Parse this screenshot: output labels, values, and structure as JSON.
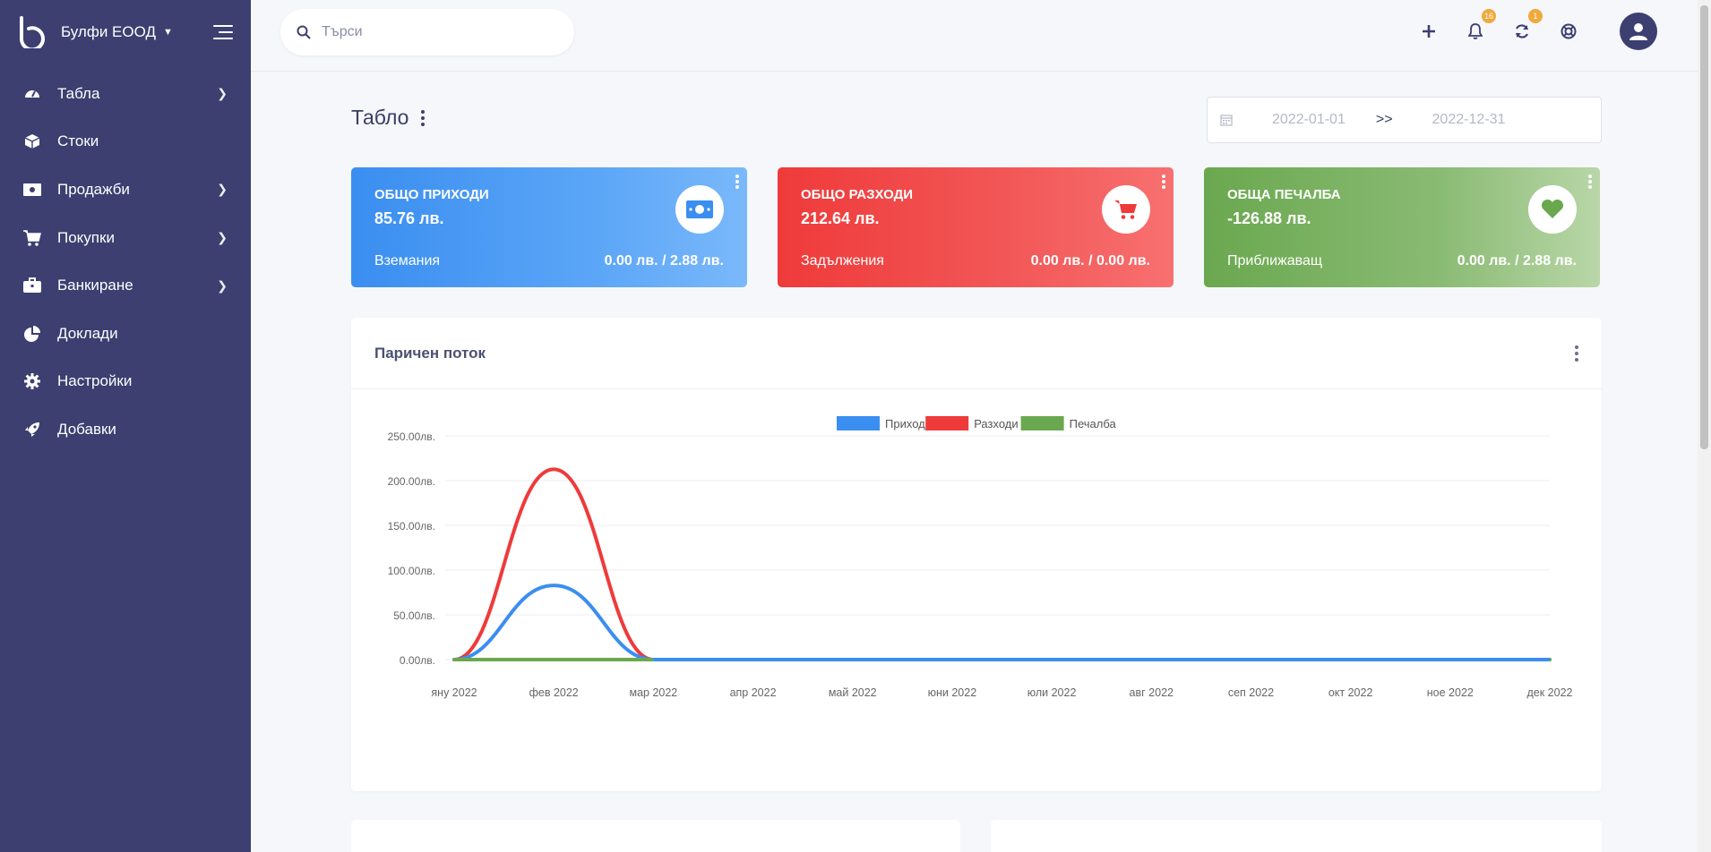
{
  "sidebar": {
    "company": "Булфи ЕООД",
    "items": [
      {
        "label": "Табла",
        "icon": "gauge-icon",
        "has_children": true
      },
      {
        "label": "Стоки",
        "icon": "cube-icon",
        "has_children": false
      },
      {
        "label": "Продажби",
        "icon": "money-bill-icon",
        "has_children": true
      },
      {
        "label": "Покупки",
        "icon": "shopping-cart-icon",
        "has_children": true
      },
      {
        "label": "Банкиране",
        "icon": "briefcase-icon",
        "has_children": true
      },
      {
        "label": "Доклади",
        "icon": "chart-pie-icon",
        "has_children": false
      },
      {
        "label": "Настройки",
        "icon": "gear-icon",
        "has_children": false
      },
      {
        "label": "Добавки",
        "icon": "rocket-icon",
        "has_children": false
      }
    ]
  },
  "topbar": {
    "search_placeholder": "Търси",
    "notifications_count": "16",
    "updates_count": "1"
  },
  "dashboard": {
    "title": "Табло",
    "date_from": "2022-01-01",
    "date_sep": ">>",
    "date_to": "2022-12-31"
  },
  "cards": {
    "income": {
      "title": "ОБЩО ПРИХОДИ",
      "amount": "85.76 лв.",
      "sub_label": "Вземания",
      "sub_value": "0.00 лв. / 2.88 лв.",
      "color": "#3a8ef0"
    },
    "expense": {
      "title": "ОБЩО РАЗХОДИ",
      "amount": "212.64 лв.",
      "sub_label": "Задължения",
      "sub_value": "0.00 лв. / 0.00 лв.",
      "color": "#ef3a3a"
    },
    "profit": {
      "title": "ОБЩА ПЕЧАЛБА",
      "amount": "-126.88 лв.",
      "sub_label": "Приближаващ",
      "sub_value": "0.00 лв. / 2.88 лв.",
      "color": "#6aa84f"
    }
  },
  "cashflow": {
    "title": "Паричен поток"
  },
  "chart_data": {
    "type": "line",
    "title": "",
    "xlabel": "",
    "ylabel": "",
    "categories": [
      "яну 2022",
      "фев 2022",
      "мар 2022",
      "апр 2022",
      "май 2022",
      "юни 2022",
      "юли 2022",
      "авг 2022",
      "сеп 2022",
      "окт 2022",
      "ное 2022",
      "дек 2022"
    ],
    "y_ticks": [
      "0.00лв.",
      "50.00лв.",
      "100.00лв.",
      "150.00лв.",
      "200.00лв.",
      "250.00лв."
    ],
    "ylim": [
      0,
      250
    ],
    "legend_position": "top",
    "grid": true,
    "series": [
      {
        "name": "Приход",
        "color": "#3a8ef0",
        "values": [
          0,
          82.88,
          0,
          0,
          0,
          0,
          0,
          0,
          0,
          0,
          0,
          0
        ]
      },
      {
        "name": "Разходи",
        "color": "#ef3a3a",
        "values": [
          0,
          212.64,
          0,
          0,
          0,
          0,
          0,
          0,
          0,
          0,
          0,
          0
        ]
      },
      {
        "name": "Печалба",
        "color": "#6aa84f",
        "values": [
          0,
          0,
          0,
          0,
          0,
          0,
          0,
          0,
          0,
          0,
          0,
          0
        ]
      }
    ]
  }
}
